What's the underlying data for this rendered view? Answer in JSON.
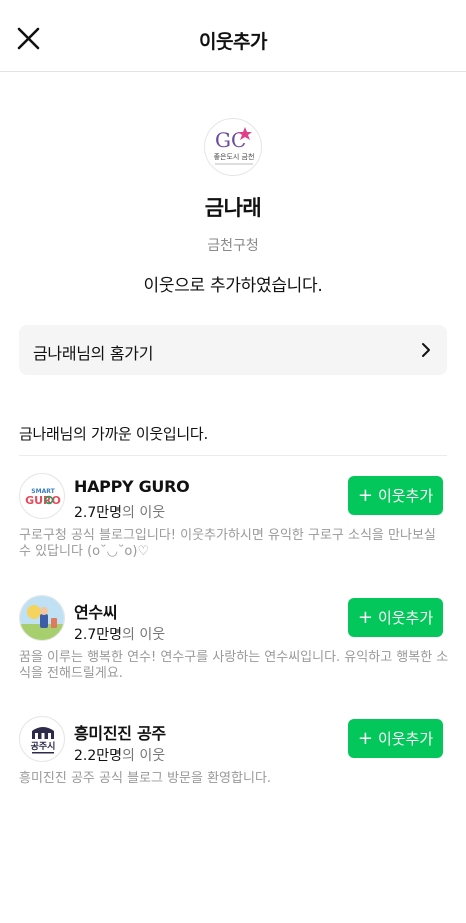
{
  "header": {
    "title": "이웃추가",
    "close_icon": "close-icon"
  },
  "profile": {
    "logo_text": "GC",
    "logo_caption": "좋은도시 금천",
    "name": "금나래",
    "subtitle": "금천구청",
    "message": "이웃으로 추가하였습니다."
  },
  "home_link": {
    "label": "금나래님의 홈가기",
    "icon": "chevron-right-icon"
  },
  "section": {
    "title": "금나래님의 가까운 이웃입니다."
  },
  "neighbors": [
    {
      "name": "HAPPY GURO",
      "count": "2.7만명",
      "count_unit": "의 이웃",
      "button_label": "이웃추가",
      "description": "구로구청 공식 블로그입니다! 이웃추가하시면 유익한 구로구 소식을 만나보실 수 있답니다 (o˘◡˘o)♡",
      "avatar": {
        "label_top": "SMART",
        "label_main": "GURO"
      }
    },
    {
      "name": "연수씨",
      "count": "2.7만명",
      "count_unit": "의 이웃",
      "button_label": "이웃추가",
      "description": "꿈을 이루는 행복한 연수! 연수구를 사랑하는 연수씨입니다. 유익하고 행복한 소식을 전해드릴게요."
    },
    {
      "name": "흥미진진 공주",
      "count": "2.2만명",
      "count_unit": "의 이웃",
      "button_label": "이웃추가",
      "description": "흥미진진 공주 공식 블로그 방문을 환영합니다.",
      "avatar": {
        "label_main": "공주시"
      }
    }
  ],
  "colors": {
    "accent": "#03c75a",
    "logo_purple": "#6a4aa0",
    "logo_pink": "#e0408a"
  }
}
